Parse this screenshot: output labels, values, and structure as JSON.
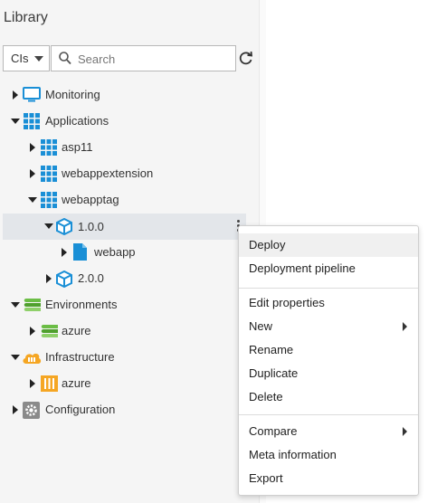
{
  "library": {
    "title": "Library",
    "type_select": "CIs",
    "search_placeholder": "Search"
  },
  "tree": {
    "monitoring": "Monitoring",
    "applications": "Applications",
    "asp11": "asp11",
    "webappextension": "webappextension",
    "webapptag": "webapptag",
    "v100": "1.0.0",
    "webapp": "webapp",
    "v200": "2.0.0",
    "environments": "Environments",
    "env_azure": "azure",
    "infrastructure": "Infrastructure",
    "infra_azure": "azure",
    "configuration": "Configuration"
  },
  "menu": {
    "deploy": "Deploy",
    "deployment_pipeline": "Deployment pipeline",
    "edit_properties": "Edit properties",
    "new": "New",
    "rename": "Rename",
    "duplicate": "Duplicate",
    "delete": "Delete",
    "compare": "Compare",
    "meta_information": "Meta information",
    "export": "Export"
  },
  "colors": {
    "app_blue": "#1a8fd6",
    "env_green": "#6bbd45",
    "infra_orange": "#f5a623",
    "config_gray": "#8a8a8a"
  }
}
